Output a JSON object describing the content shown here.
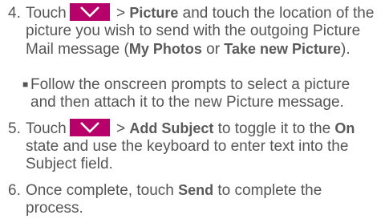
{
  "steps": [
    {
      "number": "4.",
      "text_a": "Touch",
      "text_b": " > ",
      "bold_a": "Picture",
      "text_c": " and touch the location of the",
      "line2": "picture you wish to send with the outgoing Picture",
      "line3_a": "Mail message (",
      "bold_b": "My Photos",
      "line3_b": " or ",
      "bold_c": "Take new Picture",
      "line3_c": ").",
      "icon": "chevron-down-icon"
    },
    {
      "bullet_line1": "Follow the onscreen prompts to select a picture",
      "bullet_line2": "and then attach it to the new Picture message."
    },
    {
      "number": "5.",
      "text_a": "Touch",
      "text_b": " > ",
      "bold_a": "Add Subject",
      "text_c": " to toggle it to the ",
      "bold_b": "On",
      "line2": "state and use the keyboard to enter text into the",
      "line3": "Subject field.",
      "icon": "chevron-down-icon"
    },
    {
      "number": "6.",
      "text_a": "Once complete, touch ",
      "bold_a": "Send",
      "text_b": " to complete the",
      "line2": "process."
    }
  ],
  "colors": {
    "icon_bg": "#b8006a",
    "text": "#555555"
  }
}
